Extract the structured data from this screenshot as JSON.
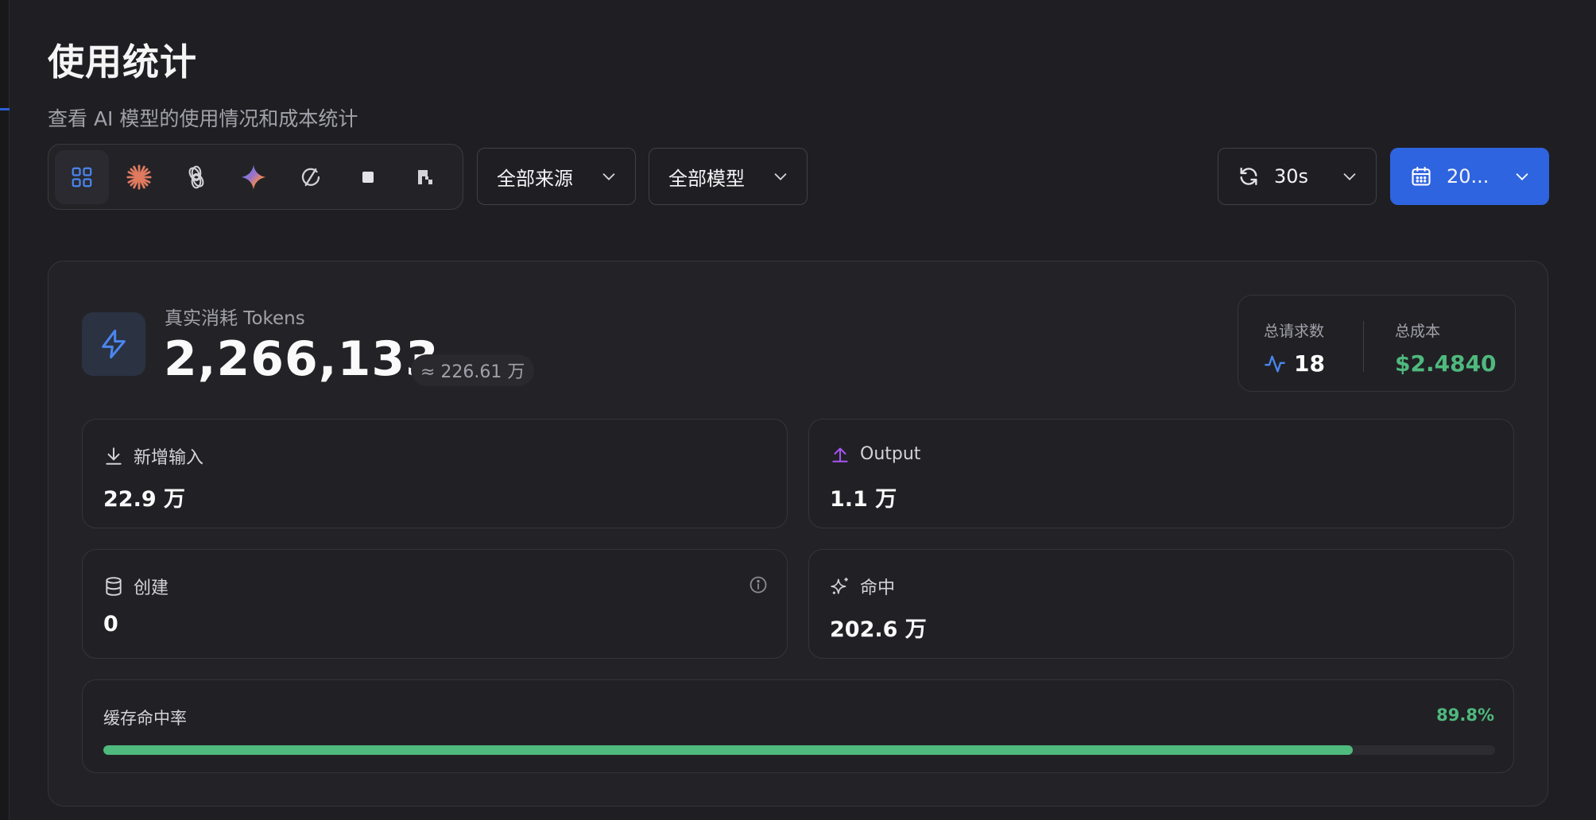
{
  "page": {
    "title": "使用统计",
    "subtitle": "查看 AI 模型的使用情况和成本统计"
  },
  "providers": [
    {
      "name": "all-providers",
      "icon": "grid-icon",
      "active": true
    },
    {
      "name": "claude",
      "icon": "claude-burst-icon",
      "active": false
    },
    {
      "name": "openai",
      "icon": "openai-knot-icon",
      "active": false
    },
    {
      "name": "gemini",
      "icon": "gemini-sparkle-icon",
      "active": false
    },
    {
      "name": "provider-slash",
      "icon": "slash-circle-icon",
      "active": false
    },
    {
      "name": "provider-square",
      "icon": "square-icon",
      "active": false
    },
    {
      "name": "provider-block",
      "icon": "block-logo-icon",
      "active": false
    }
  ],
  "filters": {
    "source": "全部来源",
    "model": "全部模型",
    "refresh": "30s",
    "date": "20..."
  },
  "tokens": {
    "label": "真实消耗 Tokens",
    "value": "2,266,133",
    "approx": "≈ 226.61 万"
  },
  "summary": {
    "requests_label": "总请求数",
    "requests_value": "18",
    "cost_label": "总成本",
    "cost_value": "$2.4840"
  },
  "metrics": {
    "input": {
      "label": "新增输入",
      "value": "22.9 万"
    },
    "output": {
      "label": "Output",
      "value": "1.1 万"
    },
    "created": {
      "label": "创建",
      "value": "0"
    },
    "hit": {
      "label": "命中",
      "value": "202.6 万"
    }
  },
  "cache": {
    "label": "缓存命中率",
    "rate": "89.8%",
    "fraction": 0.898
  },
  "colors": {
    "accent": "#2f64e0",
    "success": "#4fb97e",
    "output": "#a855f7",
    "claude": "#e07a5f"
  }
}
